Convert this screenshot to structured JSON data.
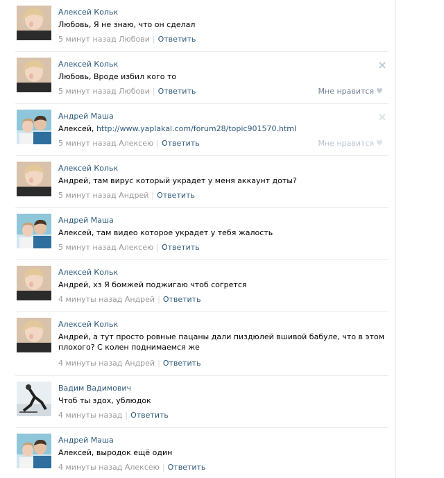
{
  "comments": [
    {
      "author": "Алексей Кольк",
      "text": "Любовь, Я не знаю, что он сделал",
      "time": "5 минут назад Любови",
      "reply": "Ответить",
      "avatar": "girl"
    },
    {
      "author": "Алексей Кольк",
      "text": "Любовь, Вроде избил кого то",
      "time": "5 минут назад Любови",
      "reply": "Ответить",
      "like": "Мне нравится",
      "avatar": "girl"
    },
    {
      "author": "Андрей Маша",
      "text_prefix": "Алексей, ",
      "link": "http://www.yaplakal.com/forum28/topic901570.html",
      "time": "5 минут назад Алексею",
      "reply": "Ответить",
      "like": "Мне нравится",
      "avatar": "couple"
    },
    {
      "author": "Алексей Кольк",
      "text": "Андрей, там вирус который украдет у меня аккаунт доты?",
      "time": "5 минут назад Андрей",
      "reply": "Ответить",
      "avatar": "girl"
    },
    {
      "author": "Андрей Маша",
      "text": "Алексей, там видео которое украдет у тебя жалость",
      "time": "5 минут назад Алексею",
      "reply": "Ответить",
      "avatar": "couple"
    },
    {
      "author": "Алексей Кольк",
      "text": "Андрей, хз Я бомжей поджигаю чтоб согрется",
      "time": "4 минуты назад Андрей",
      "reply": "Ответить",
      "avatar": "girl"
    },
    {
      "author": "Алексей Кольк",
      "text": "Андрей, а тут просто ровные пацаны дали пиздюлей вшивой бабуле, что в этом плохого? С колен поднимаемся же",
      "time": "4 минуты назад Андрей",
      "reply": "Ответить",
      "avatar": "girl"
    },
    {
      "author": "Вадим Вадимович",
      "text": "Чтоб ты здох, ублюдок",
      "time": "4 минуты назад",
      "reply": "Ответить",
      "avatar": "skater"
    },
    {
      "author": "Андрей Маша",
      "text": "Алексей, выродок ещё один",
      "time": "4 минуты назад Алексею",
      "reply": "Ответить",
      "avatar": "couple"
    }
  ],
  "colors": {
    "link": "#2b587a",
    "meta": "#999999",
    "separator": "#e7ebef"
  },
  "icons": {
    "close": "close-icon",
    "heart": "heart-icon"
  }
}
